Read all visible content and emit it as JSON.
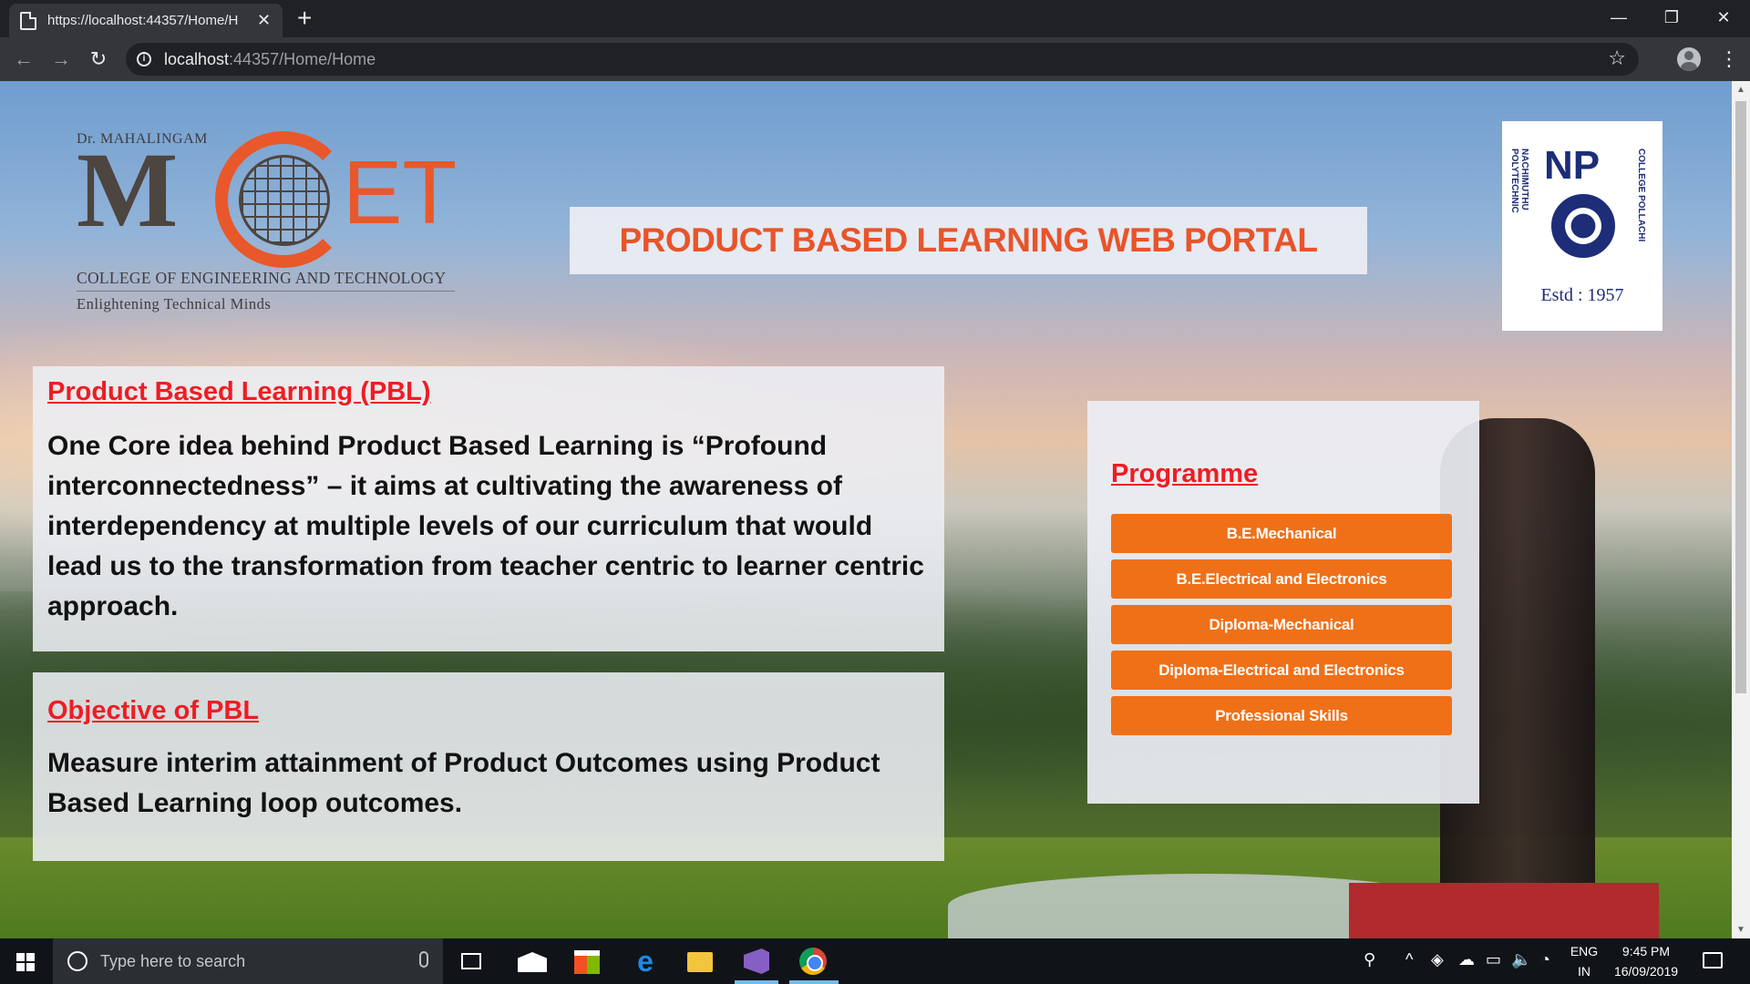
{
  "browser": {
    "tab_title": "https://localhost:44357/Home/H",
    "url_host": "localhost",
    "url_path": ":44357/Home/Home"
  },
  "header": {
    "college_logo": {
      "prefix": "Dr. MAHALINGAM",
      "letter_m": "M",
      "letters_et": "ET",
      "college_name": "COLLEGE OF ENGINEERING AND TECHNOLOGY",
      "tagline": "Enlightening Technical Minds"
    },
    "portal_title": "PRODUCT BASED LEARNING WEB PORTAL",
    "np_logo": {
      "initials": "NP",
      "arc_left": "NACHIMUTHU POLYTECHNIC",
      "arc_right": "COLLEGE POLLACHI",
      "estd": "Estd : 1957"
    }
  },
  "pbl": {
    "heading": "Product Based Learning (PBL)",
    "body": "One Core idea behind Product Based Learning is “Profound interconnectedness” – it aims at cultivating the awareness of interdependency at multiple levels of our curriculum that would lead us to the transformation from teacher centric to learner centric approach."
  },
  "objective": {
    "heading": "Objective of PBL",
    "body": "Measure interim attainment of Product Outcomes using Product Based Learning loop outcomes."
  },
  "programme": {
    "heading": "Programme",
    "items": [
      "B.E.Mechanical",
      "B.E.Electrical and Electronics",
      "Diploma-Mechanical",
      "Diploma-Electrical and Electronics",
      "Professional Skills"
    ]
  },
  "taskbar": {
    "search_placeholder": "Type here to search",
    "language_top": "ENG",
    "language_bottom": "IN",
    "time": "9:45 PM",
    "date": "16/09/2019"
  },
  "colors": {
    "accent_orange": "#f07018",
    "heading_red": "#ee1d24",
    "title_orange": "#e8542a"
  }
}
